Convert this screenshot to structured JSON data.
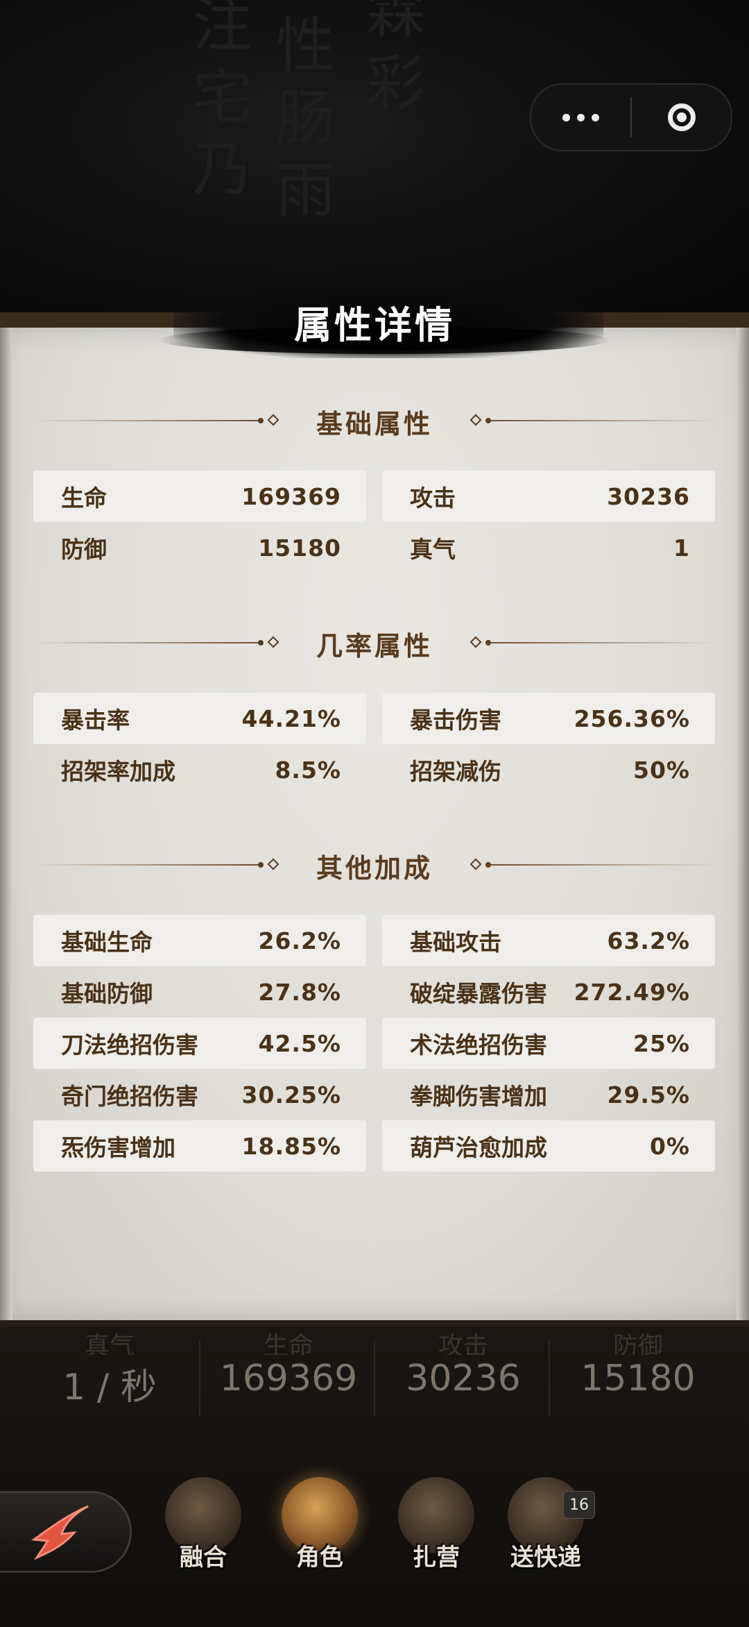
{
  "header": {
    "title": "属性详情"
  },
  "capsule": {
    "more_icon": "more-dots-icon",
    "close_icon": "target-close-icon"
  },
  "sections": [
    {
      "label": "基础属性",
      "rows": [
        [
          {
            "name": "生命",
            "value": "169369"
          },
          {
            "name": "攻击",
            "value": "30236"
          }
        ],
        [
          {
            "name": "防御",
            "value": "15180"
          },
          {
            "name": "真气",
            "value": "1"
          }
        ]
      ]
    },
    {
      "label": "几率属性",
      "rows": [
        [
          {
            "name": "暴击率",
            "value": "44.21%"
          },
          {
            "name": "暴击伤害",
            "value": "256.36%"
          }
        ],
        [
          {
            "name": "招架率加成",
            "value": "8.5%"
          },
          {
            "name": "招架减伤",
            "value": "50%"
          }
        ]
      ]
    },
    {
      "label": "其他加成",
      "rows": [
        [
          {
            "name": "基础生命",
            "value": "26.2%"
          },
          {
            "name": "基础攻击",
            "value": "63.2%"
          }
        ],
        [
          {
            "name": "基础防御",
            "value": "27.8%"
          },
          {
            "name": "破绽暴露伤害",
            "value": "272.49%"
          }
        ],
        [
          {
            "name": "刀法绝招伤害",
            "value": "42.5%"
          },
          {
            "name": "术法绝招伤害",
            "value": "25%"
          }
        ],
        [
          {
            "name": "奇门绝招伤害",
            "value": "30.25%"
          },
          {
            "name": "拳脚伤害增加",
            "value": "29.5%"
          }
        ],
        [
          {
            "name": "炁伤害增加",
            "value": "18.85%"
          },
          {
            "name": "葫芦治愈加成",
            "value": "0%"
          }
        ]
      ]
    }
  ],
  "bottom_stats": [
    {
      "label": "真气",
      "value": "1 / 秒"
    },
    {
      "label": "生命",
      "value": "169369"
    },
    {
      "label": "攻击",
      "value": "30236"
    },
    {
      "label": "防御",
      "value": "15180"
    }
  ],
  "nav": {
    "back_icon": "red-arrow-back-icon",
    "items": [
      {
        "label": "融合",
        "icon": "yin-yang-icon",
        "active": false
      },
      {
        "label": "角色",
        "icon": "character-icon",
        "active": true
      },
      {
        "label": "扎营",
        "icon": "camp-kettle-icon",
        "active": false
      },
      {
        "label": "送快递",
        "icon": "delivery-icon",
        "active": false,
        "badge": "16"
      }
    ]
  },
  "colors": {
    "text_brown": "#4a3218",
    "heading_brown": "#5a3b1f",
    "panel_bg": "#e3e1dc",
    "row_shade": "#efeeeb"
  }
}
